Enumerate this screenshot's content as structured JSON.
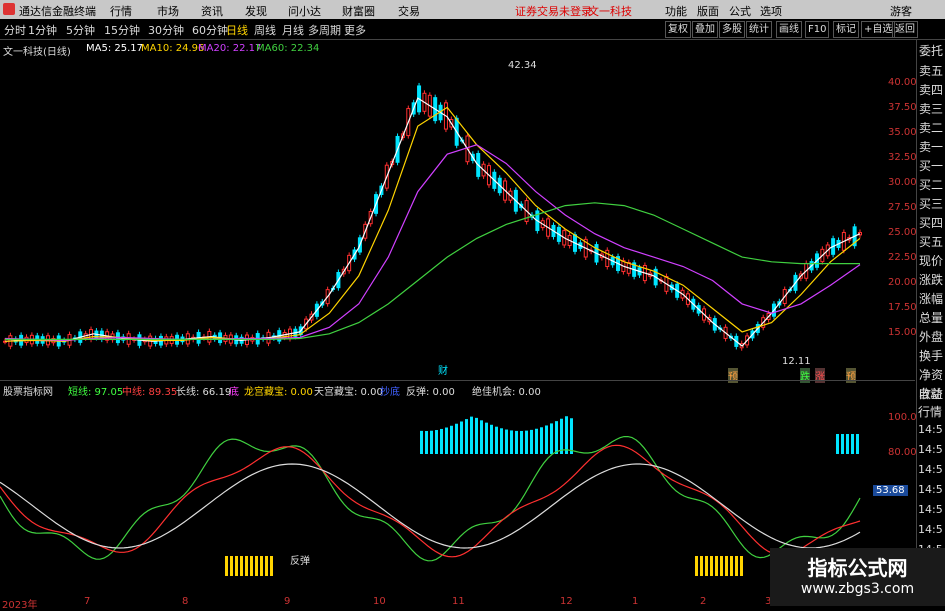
{
  "titlebar": {
    "app": "通达信金融终端",
    "menus": [
      "行情",
      "市场",
      "资讯",
      "发现",
      "问小达",
      "财富圈",
      "交易"
    ],
    "notice": "证券交易未登录",
    "brand": "文一科技",
    "right": [
      "功能",
      "版面",
      "公式",
      "选项"
    ],
    "guest": "游客"
  },
  "toolbar": {
    "periods": [
      "分时",
      "1分钟",
      "5分钟",
      "15分钟",
      "30分钟",
      "60分钟",
      "日线",
      "周线",
      "月线",
      "多周期",
      "更多"
    ],
    "active": "日线",
    "right": [
      "复权",
      "叠加",
      "多股",
      "统计",
      "画线",
      "F10",
      "标记",
      "+自选",
      "返回"
    ]
  },
  "chart_info": {
    "stock": "文一科技(日线)",
    "ma5": "MA5: 25.17",
    "ma10": "MA10: 24.96",
    "ma20": "MA20: 22.17",
    "ma60": "MA60: 22.34",
    "high_label": "42.34",
    "low_label": "12.11",
    "signs": [
      "财",
      "预",
      "跌",
      "涨",
      "预"
    ]
  },
  "y_axis_main": [
    "40.00",
    "37.50",
    "35.00",
    "32.50",
    "30.00",
    "27.50",
    "25.00",
    "22.50",
    "20.00",
    "17.50",
    "15.00"
  ],
  "right_tabs": [
    "委托",
    "卖五",
    "卖四",
    "卖三",
    "卖二",
    "卖一",
    "买一",
    "买二",
    "买三",
    "买四",
    "买五",
    "现价",
    "涨跌",
    "涨幅",
    "总量",
    "外盘",
    "换手",
    "净资",
    "收益",
    "自动",
    "行情",
    "14:5",
    "14:5",
    "14:5",
    "14:5",
    "14:5",
    "14:5",
    "14:5"
  ],
  "indicator": {
    "name": "股票指标网",
    "short": "短线: 97.05",
    "mid": "中线: 89.35",
    "long": "长线: 66.19",
    "tag1": "底",
    "dragon": "龙宫藏宝: 0.00",
    "sky": "天宫藏宝: 0.00",
    "tag2": "抄底",
    "rebound": "反弹: 0.00",
    "best": "绝佳机会: 0.00",
    "rebound_mark": "反弹",
    "current": "53.68"
  },
  "y_axis_ind": [
    "100.0",
    "80.00"
  ],
  "dates": [
    "2023年",
    "7",
    "8",
    "9",
    "10",
    "11",
    "12",
    "1",
    "2",
    "3",
    "4"
  ],
  "watermark": {
    "t1": "指标公式网",
    "t2": "www.zbgs3.com"
  },
  "colors": {
    "up": "#ff3030",
    "down": "#00e5ff",
    "ma5": "#ffffff",
    "ma10": "#ffd400",
    "ma20": "#d040ff",
    "ma60": "#40d040"
  },
  "chart_data": {
    "type": "line",
    "title": "文一科技(日线)",
    "ylim": [
      12,
      43
    ],
    "series": [
      {
        "name": "MA5",
        "values": [
          14,
          14.2,
          14,
          14.8,
          14.3,
          14,
          14.2,
          14.5,
          14.1,
          14.4,
          15,
          19,
          24,
          32,
          40,
          38,
          33,
          30,
          27,
          25,
          23.5,
          22,
          21,
          19,
          16,
          13.5,
          17,
          21,
          24,
          25.5
        ]
      },
      {
        "name": "MA10",
        "values": [
          14,
          14.1,
          14,
          14.5,
          14.4,
          14.1,
          14.1,
          14.4,
          14.2,
          14.3,
          14.7,
          17,
          21,
          28,
          37,
          39,
          35,
          32,
          28.5,
          26,
          24,
          22.5,
          21.5,
          20,
          17.5,
          15,
          16,
          19,
          22.5,
          25
        ]
      },
      {
        "name": "MA20",
        "values": [
          14.3,
          14.2,
          14.1,
          14.3,
          14.4,
          14.3,
          14.2,
          14.2,
          14.3,
          14.3,
          14.4,
          15.5,
          18,
          23,
          30,
          34,
          35,
          33,
          30,
          27.5,
          25.5,
          24,
          23,
          22,
          20.5,
          18,
          17,
          18,
          20,
          22.2
        ]
      },
      {
        "name": "MA60",
        "values": [
          14.2,
          14.2,
          14.2,
          14.2,
          14.2,
          14.2,
          14.2,
          14.2,
          14.2,
          14.2,
          14.3,
          14.8,
          16,
          18,
          20.5,
          23,
          25,
          26.5,
          27.5,
          28.5,
          28.8,
          28.5,
          27.5,
          26,
          24.5,
          23,
          22.5,
          22.3,
          22.3,
          22.3
        ]
      }
    ]
  }
}
